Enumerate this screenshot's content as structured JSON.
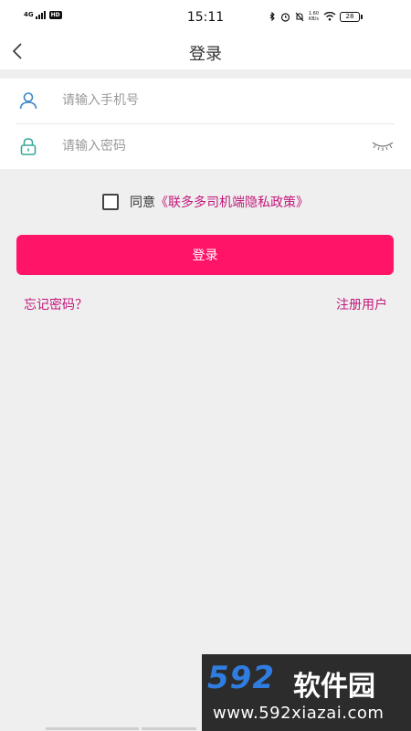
{
  "status_bar": {
    "network": "4G",
    "hd_badge": "HD",
    "time": "15:11",
    "speed_value": "1.60",
    "speed_unit": "KB/s",
    "battery": "28"
  },
  "nav": {
    "back_icon": "chevron-left-icon",
    "title": "登录"
  },
  "form": {
    "phone": {
      "icon": "user-icon",
      "placeholder": "请输入手机号",
      "value": ""
    },
    "password": {
      "icon": "lock-icon",
      "placeholder": "请输入密码",
      "value": "",
      "toggle_icon": "eye-closed-icon"
    }
  },
  "agreement": {
    "checked": false,
    "text": "同意",
    "policy_link": "《联多多司机端隐私政策》"
  },
  "login_button": {
    "label": "登录"
  },
  "links": {
    "forgot": "忘记密码？",
    "register": "注册用户"
  },
  "watermark": {
    "logo_number": "592",
    "logo_text": "软件园",
    "url": "www.592xiazai.com"
  },
  "colors": {
    "accent": "#ff1468",
    "link": "#c2187a",
    "icon_blue": "#3a86c8",
    "icon_green": "#3aa89a",
    "background": "#efefef"
  }
}
